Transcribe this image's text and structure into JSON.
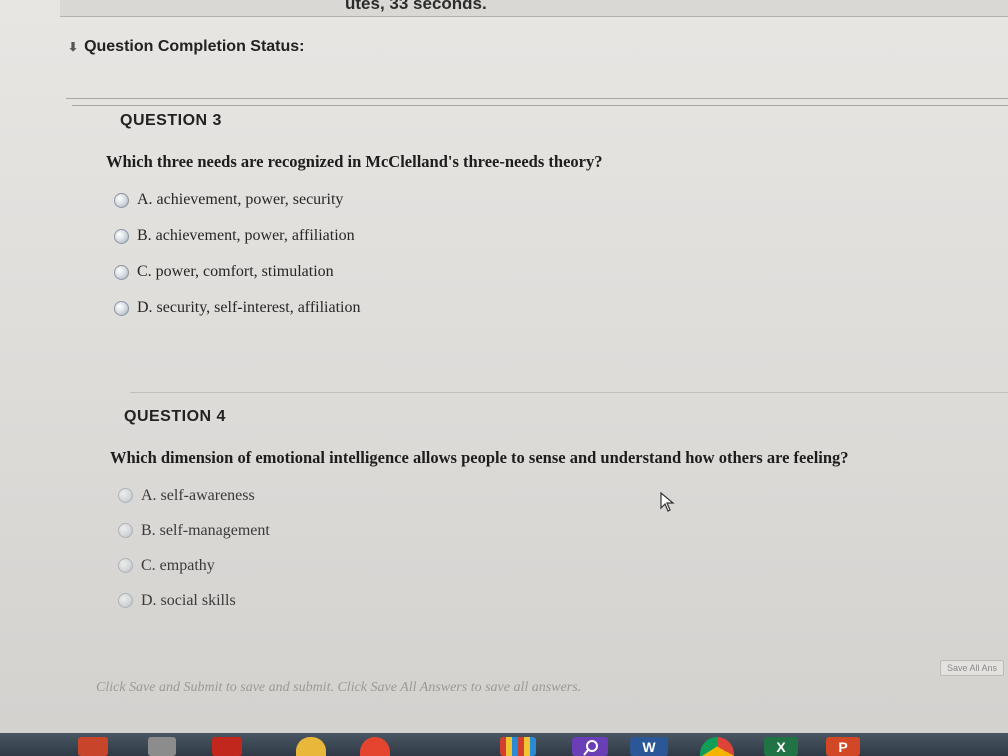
{
  "timer": {
    "text": "utes, 33 seconds."
  },
  "status": {
    "label": "Question Completion Status:"
  },
  "questions": [
    {
      "heading": "QUESTION 3",
      "text": "Which three needs are recognized in McClelland's three-needs theory?",
      "options": [
        "A. achievement, power, security",
        "B. achievement, power, affiliation",
        "C. power, comfort, stimulation",
        "D. security, self-interest, affiliation"
      ]
    },
    {
      "heading": "QUESTION 4",
      "text": "Which dimension of emotional intelligence allows people to sense and understand how others are feeling?",
      "options": [
        "A. self-awareness",
        "B. self-management",
        "C. empathy",
        "D. social skills"
      ]
    }
  ],
  "footer": {
    "note": "Click Save and Submit to save and submit. Click Save All Answers to save all answers.",
    "save_all_label": "Save All Ans"
  },
  "taskbar": {
    "word_label": "W",
    "excel_label": "X",
    "powerpoint_label": "P"
  },
  "colors": {
    "word": "#2b5797",
    "excel": "#217346",
    "powerpoint": "#d24726",
    "search": "#6a3fb5",
    "acrobat": "#c1271d"
  }
}
